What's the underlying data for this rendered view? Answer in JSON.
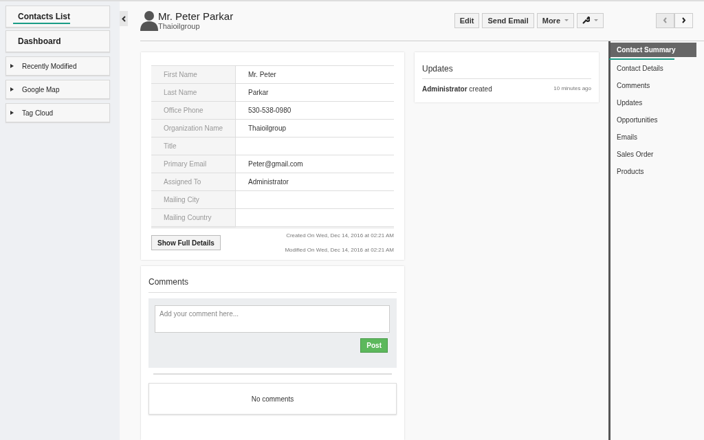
{
  "sidebar": {
    "items": [
      {
        "label": "Contacts List",
        "kind": "main",
        "selected": true
      },
      {
        "label": "Dashboard",
        "kind": "main",
        "selected": false
      },
      {
        "label": "Recently Modified",
        "kind": "widget"
      },
      {
        "label": "Google Map",
        "kind": "widget"
      },
      {
        "label": "Tag Cloud",
        "kind": "widget"
      }
    ]
  },
  "header": {
    "title": "Mr. Peter Parkar",
    "subtitle": "Thaioilgroup",
    "buttons": [
      {
        "label": "Edit",
        "kind": "text"
      },
      {
        "label": "Send Email",
        "kind": "text"
      },
      {
        "label": "More",
        "kind": "dropdown"
      },
      {
        "kind": "tools"
      }
    ],
    "pager": [
      {
        "kind": "prev",
        "disabled": true
      },
      {
        "kind": "next",
        "disabled": false
      }
    ]
  },
  "details": {
    "rows": [
      {
        "label": "First Name",
        "value": "Mr. Peter"
      },
      {
        "label": "Last Name",
        "value": "Parkar"
      },
      {
        "label": "Office Phone",
        "value": "530-538-0980"
      },
      {
        "label": "Organization Name",
        "value": "Thaioilgroup"
      },
      {
        "label": "Title",
        "value": ""
      },
      {
        "label": "Primary Email",
        "value": "Peter@gmail.com"
      },
      {
        "label": "Assigned To",
        "value": "Administrator"
      },
      {
        "label": "Mailing City",
        "value": ""
      },
      {
        "label": "Mailing Country",
        "value": ""
      }
    ],
    "show_button": "Show Full Details",
    "created": "Created On Wed, Dec 14, 2016 at 02:21 AM",
    "modified": "Modified On Wed, Dec 14, 2016 at 02:21 AM"
  },
  "comments": {
    "title": "Comments",
    "placeholder": "Add your comment here...",
    "post_button": "Post",
    "empty_text": "No comments"
  },
  "updates": {
    "title": "Updates",
    "entries": [
      {
        "text": "**Administrator** created",
        "time": "10 minutes ago"
      }
    ]
  },
  "right_nav": {
    "items": [
      {
        "label": "Contact Summary",
        "selected": true
      },
      {
        "label": "Contact Details",
        "selected": false
      },
      {
        "label": "Comments",
        "selected": false
      },
      {
        "label": "Updates",
        "selected": false
      },
      {
        "label": "Opportunities",
        "selected": false
      },
      {
        "label": "Emails",
        "selected": false
      },
      {
        "label": "Sales Order",
        "selected": false
      },
      {
        "label": "Products",
        "selected": false
      }
    ]
  }
}
